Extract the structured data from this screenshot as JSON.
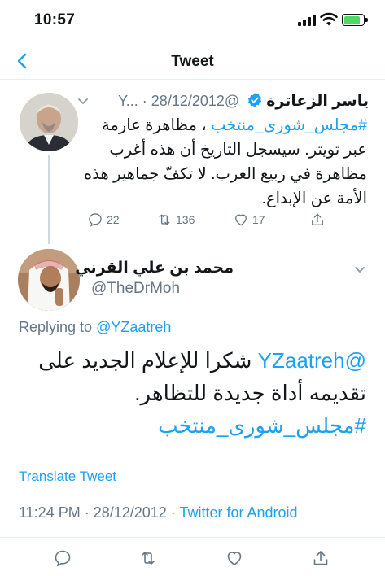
{
  "status_bar": {
    "time": "10:57"
  },
  "nav": {
    "title": "Tweet"
  },
  "parent_tweet": {
    "name": "ياسر الزعاترة",
    "handle": "@Y...",
    "date": "· 28/12/2012",
    "hashtag": "#مجلس_شورى_منتخب",
    "text": "، مظاهرة عارمة عبر تويتر. سيسجل التاريخ أن هذه أغرب مظاهرة في ربيع العرب. لا تكفّ جماهير هذه الأمة عن الإبداع.",
    "replies": "22",
    "retweets": "136",
    "likes": "17"
  },
  "main_tweet": {
    "name": "محمد بن علي القرني",
    "handle": "@TheDrMoh",
    "replying_prefix": "Replying to",
    "replying_to": "@YZaatreh",
    "mention": "@YZaatreh",
    "text": "شكرا للإعلام الجديد على تقديمه أداة جديدة للتظاهر.",
    "hashtag": "#مجلس_شورى_منتخب",
    "translate_label": "Translate Tweet",
    "timestamp": "11:24 PM · 28/12/2012 · ",
    "source": "Twitter for Android"
  },
  "colors": {
    "accent": "#1da1f2",
    "muted": "#657786",
    "verified": "#1da1f2",
    "battery": "#4cd964"
  },
  "icons": [
    "back-chevron-icon",
    "verified-badge-icon",
    "chevron-down-icon",
    "reply-icon",
    "retweet-icon",
    "like-icon",
    "share-icon"
  ]
}
